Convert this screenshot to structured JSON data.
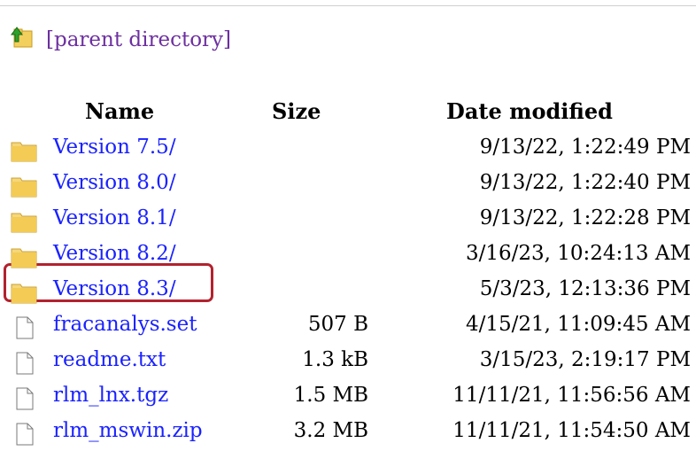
{
  "parent": {
    "label": "[parent directory]"
  },
  "columns": {
    "name": "Name",
    "size": "Size",
    "date": "Date modified"
  },
  "rows": [
    {
      "type": "folder",
      "name": "Version 7.5/",
      "size": "",
      "date": "9/13/22, 1:22:49 PM"
    },
    {
      "type": "folder",
      "name": "Version 8.0/",
      "size": "",
      "date": "9/13/22, 1:22:40 PM"
    },
    {
      "type": "folder",
      "name": "Version 8.1/",
      "size": "",
      "date": "9/13/22, 1:22:28 PM"
    },
    {
      "type": "folder",
      "name": "Version 8.2/",
      "size": "",
      "date": "3/16/23, 10:24:13 AM"
    },
    {
      "type": "folder",
      "name": "Version 8.3/",
      "size": "",
      "date": "5/3/23, 12:13:36 PM",
      "highlighted": true
    },
    {
      "type": "file",
      "name": "fracanalys.set",
      "size": "507 B",
      "date": "4/15/21, 11:09:45 AM"
    },
    {
      "type": "file",
      "name": "readme.txt",
      "size": "1.3 kB",
      "date": "3/15/23, 2:19:17 PM"
    },
    {
      "type": "file",
      "name": "rlm_lnx.tgz",
      "size": "1.5 MB",
      "date": "11/11/21, 11:56:56 AM"
    },
    {
      "type": "file",
      "name": "rlm_mswin.zip",
      "size": "3.2 MB",
      "date": "11/11/21, 11:54:50 AM"
    }
  ],
  "colors": {
    "link": "#1a22ff",
    "visited": "#6d2fa0",
    "highlight": "#b2222e",
    "folder": "#f2c94c"
  }
}
